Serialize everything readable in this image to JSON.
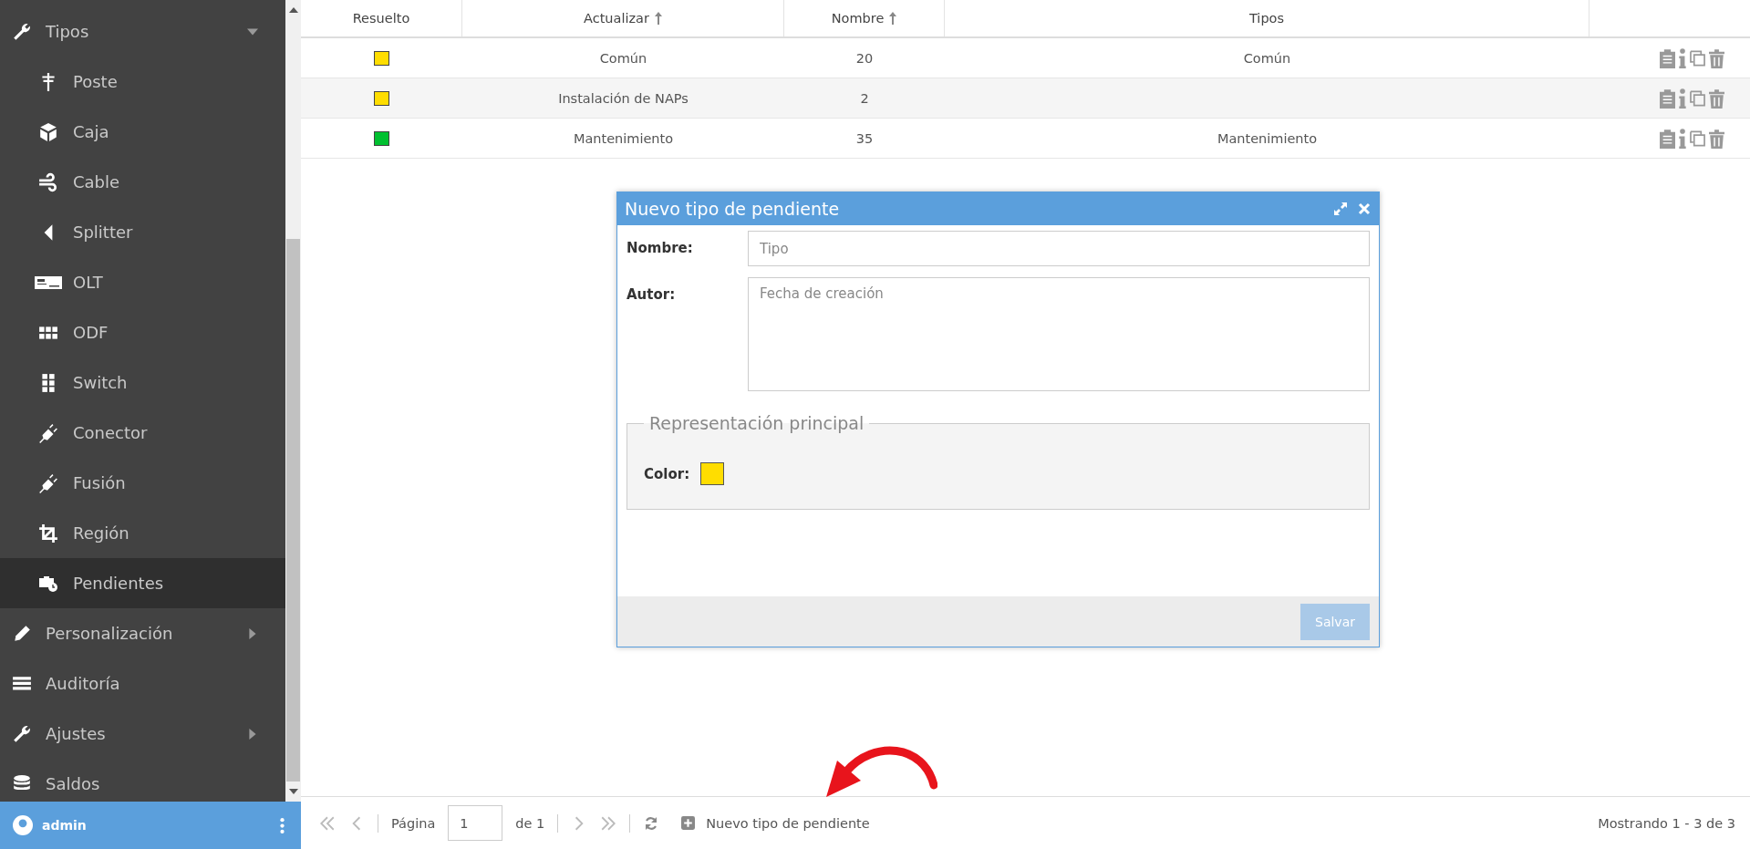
{
  "sidebar": {
    "items": [
      {
        "label": "Tipos",
        "expanded": true,
        "selected": false,
        "children": [
          {
            "label": "Poste",
            "selected": false
          },
          {
            "label": "Caja",
            "selected": false
          },
          {
            "label": "Cable",
            "selected": false
          },
          {
            "label": "Splitter",
            "selected": false
          },
          {
            "label": "OLT",
            "selected": false
          },
          {
            "label": "ODF",
            "selected": false
          },
          {
            "label": "Switch",
            "selected": false
          },
          {
            "label": "Conector",
            "selected": false
          },
          {
            "label": "Fusión",
            "selected": false
          },
          {
            "label": "Región",
            "selected": false
          },
          {
            "label": "Pendientes",
            "selected": true
          }
        ]
      },
      {
        "label": "Personalización",
        "expanded": false,
        "selected": false
      },
      {
        "label": "Auditoría",
        "selected": false
      },
      {
        "label": "Ajustes",
        "expanded": false,
        "selected": false
      },
      {
        "label": "Saldos",
        "selected": false
      }
    ],
    "user": "admin"
  },
  "table": {
    "columns": [
      {
        "label": "Resuelto",
        "sorted": false
      },
      {
        "label": "Actualizar",
        "sorted": true
      },
      {
        "label": "Nombre",
        "sorted": true
      },
      {
        "label": "Tipos",
        "sorted": false
      }
    ],
    "rows": [
      {
        "color": "#ffdd00",
        "actualizar": "Común",
        "nombre": "20",
        "tipos": "Común"
      },
      {
        "color": "#ffdd00",
        "actualizar": "Instalación de NAPs",
        "nombre": "2",
        "tipos": ""
      },
      {
        "color": "#00c030",
        "actualizar": "Mantenimiento",
        "nombre": "35",
        "tipos": "Mantenimiento"
      }
    ]
  },
  "dialog": {
    "title": "Nuevo tipo de pendiente",
    "fields": [
      {
        "kind": "input",
        "label": "Nombre:",
        "placeholder": "Tipo"
      },
      {
        "kind": "textarea",
        "label": "Autor:",
        "placeholder": "Fecha de creación"
      }
    ],
    "fieldset": {
      "legend": "Representación principal",
      "color_label": "Color:",
      "color": "#ffdd00"
    },
    "save_button": {
      "label": "Salvar",
      "disabled": true
    }
  },
  "pager": {
    "page_label": "Página",
    "page": "1",
    "of": "de 1",
    "add_button": "Nuevo tipo de pendiente",
    "status": "Mostrando 1 - 3 de 3"
  }
}
